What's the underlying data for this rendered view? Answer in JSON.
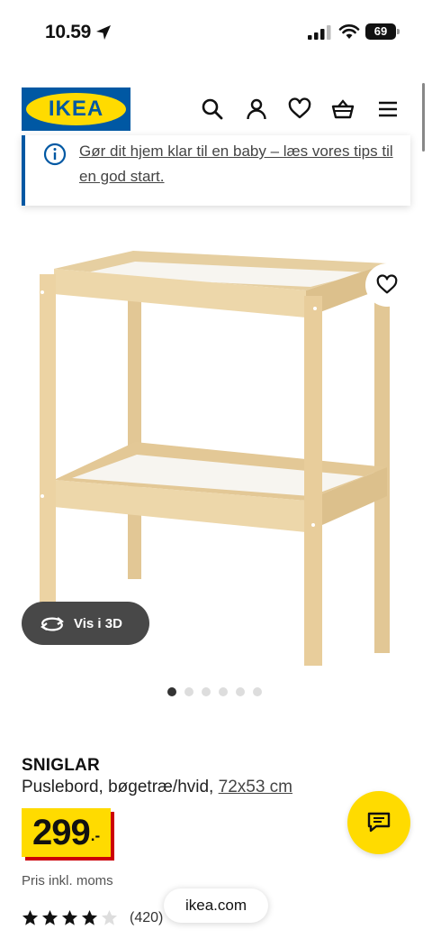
{
  "status_bar": {
    "time": "10.59",
    "battery": "69"
  },
  "header": {
    "logo_text": "IKEA",
    "icons": [
      "search-icon",
      "account-icon",
      "heart-icon",
      "basket-icon",
      "menu-icon"
    ]
  },
  "banner": {
    "text": "Gør dit hjem klar til en baby – læs vores tips til en god start."
  },
  "gallery": {
    "view3d_label": "Vis i 3D",
    "image_count": 6,
    "active_index": 0
  },
  "product": {
    "name": "SNIGLAR",
    "description": "Puslebord, bøgetræ/hvid,",
    "size": "72x53 cm",
    "price_main": "299",
    "price_decimals": ".-",
    "vat_note": "Pris inkl. moms",
    "rating": 4,
    "rating_max": 5,
    "review_count": "(420)"
  },
  "browser": {
    "url": "ikea.com"
  },
  "colors": {
    "ikea_blue": "#0058a3",
    "ikea_yellow": "#ffdb00",
    "price_red": "#cc0008",
    "wood": "#e8d2a6"
  }
}
